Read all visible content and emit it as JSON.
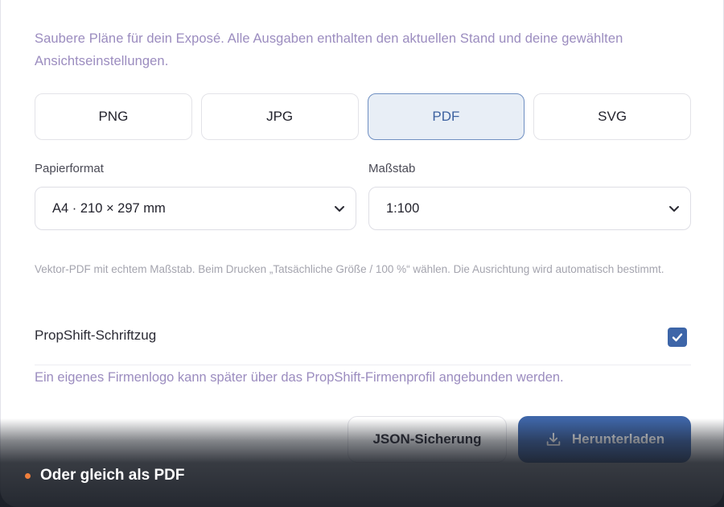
{
  "intro_text": "Saubere Pläne für dein Exposé. Alle Ausgaben enthalten den aktuellen Stand und deine gewählten Ansichtseinstellungen.",
  "formats": [
    {
      "label": "PNG",
      "active": false
    },
    {
      "label": "JPG",
      "active": false
    },
    {
      "label": "PDF",
      "active": true
    },
    {
      "label": "SVG",
      "active": false
    }
  ],
  "paper": {
    "label": "Papierformat",
    "value": "A4 · 210 × 297 mm"
  },
  "scale": {
    "label": "Maßstab",
    "value": "1:100"
  },
  "hint_text": "Vektor-PDF mit echtem Maßstab. Beim Drucken „Tatsächliche Größe / 100 %“ wählen. Die Ausrichtung wird automatisch bestimmt.",
  "branding": {
    "label": "PropShift-Schriftzug",
    "checked": true
  },
  "note_text": "Ein eigenes Firmenlogo kann später über das PropShift-Firmenprofil angebunden werden.",
  "actions": {
    "json_label": "JSON-Sicherung",
    "download_label": "Herunterladen"
  },
  "caption": {
    "text": "Oder gleich als PDF"
  },
  "colors": {
    "accent": "#3f66a8",
    "muted_purple": "#9b8cbf",
    "caption_dot": "#f07f3c"
  },
  "icons": {
    "chevron": "chevron-down-icon",
    "check": "check-icon",
    "download": "download-icon"
  }
}
